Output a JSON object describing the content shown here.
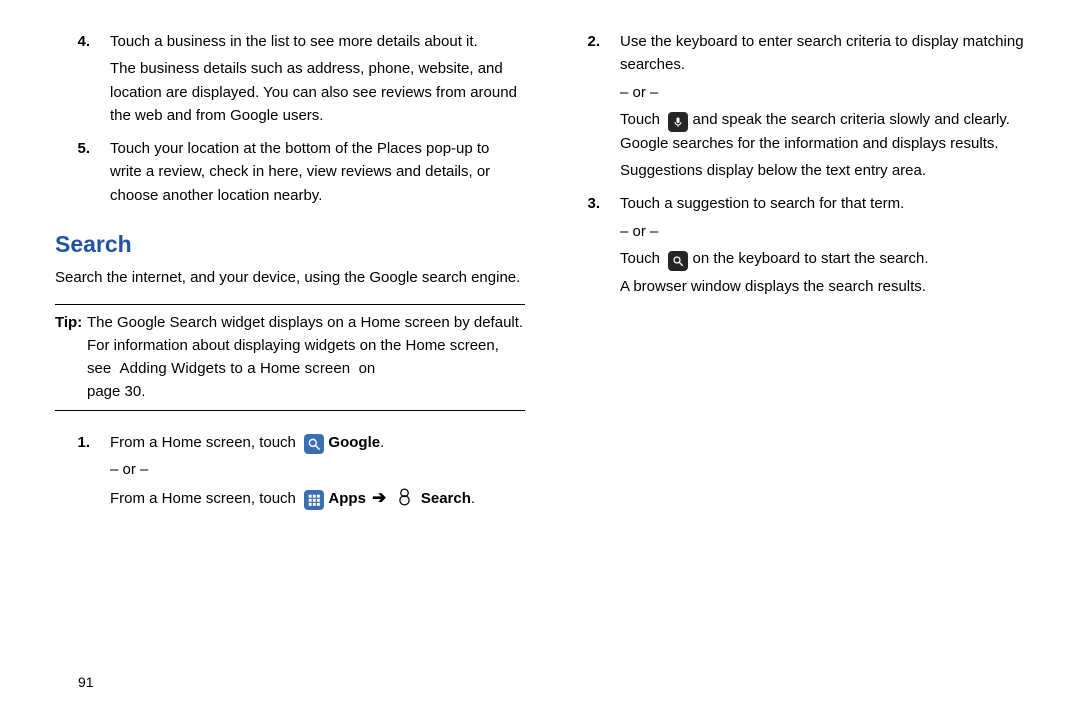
{
  "left": {
    "item4": {
      "idx": "4.",
      "p1": "Touch a business in the list to see more details about it.",
      "p2": "The business details such as address, phone, website, and location are displayed. You can also see reviews from around the web and from Google users."
    },
    "item5": {
      "idx": "5.",
      "p1": "Touch your location at the bottom of the Places pop-up to write a review, check in here, view reviews and details, or choose another location nearby."
    },
    "heading": "Search",
    "intro": "Search the internet, and your device, using the Google search engine.",
    "tip": {
      "label": "Tip:",
      "body_pre": "The Google Search widget displays on a Home screen by default. For information about displaying widgets on the Home screen, see",
      "link": "Adding Widgets to a Home screen",
      "on": "on",
      "page": "page 30."
    },
    "item1": {
      "idx": "1.",
      "p1_a": "From a Home screen, touch",
      "google": "Google",
      "period": ".",
      "or": "– or –",
      "p2_a": "From a Home screen, touch",
      "apps": "Apps",
      "search": "Search",
      "period2": "."
    }
  },
  "right": {
    "item2": {
      "idx": "2.",
      "p1": "Use the keyboard to enter search criteria to display matching searches.",
      "or": "– or –",
      "p2_a": "Touch",
      "p2_b": "and speak the search criteria slowly and clearly. Google searches for the information and displays results.",
      "p3": "Suggestions display below the text entry area."
    },
    "item3": {
      "idx": "3.",
      "p1": "Touch a suggestion to search for that term.",
      "or": "– or –",
      "p2_a": "Touch",
      "p2_b": "on the keyboard to start the search.",
      "p3": "A browser window displays the search results."
    }
  },
  "page_number": "91"
}
